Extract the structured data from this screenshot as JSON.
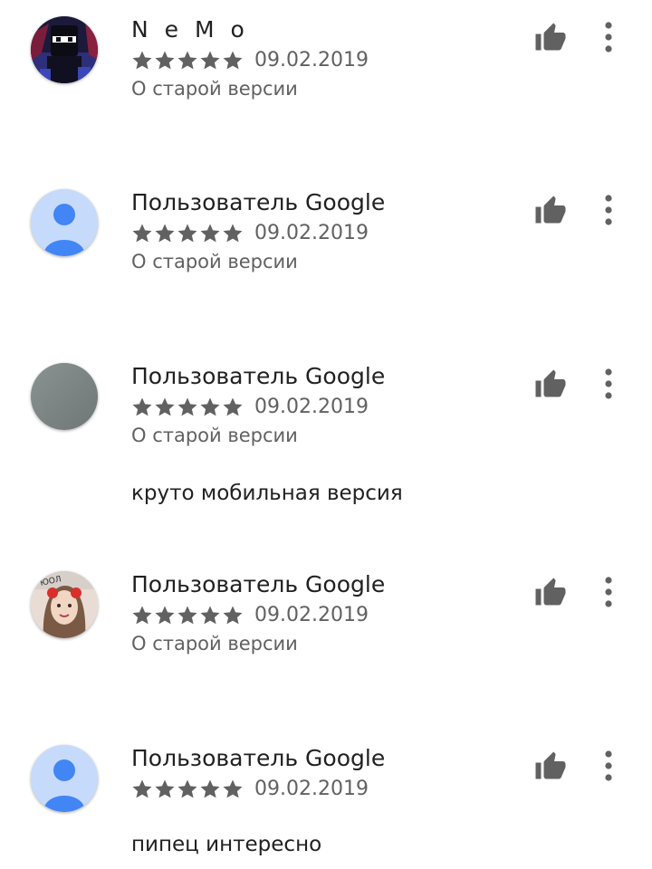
{
  "reviews": [
    {
      "author": "N e M o",
      "rating": 5,
      "date": "09.02.2019",
      "version_note": "О старой версии",
      "text": "",
      "avatar": "ninja-avatar"
    },
    {
      "author": "Пользователь Google",
      "rating": 5,
      "date": "09.02.2019",
      "version_note": "О старой версии",
      "text": "",
      "avatar": "default-user-avatar"
    },
    {
      "author": "Пользователь Google",
      "rating": 5,
      "date": "09.02.2019",
      "version_note": "О старой версии",
      "text": "круто мобильная версия",
      "avatar": "gray-avatar"
    },
    {
      "author": "Пользователь Google",
      "rating": 5,
      "date": "09.02.2019",
      "version_note": "О старой версии",
      "text": "",
      "avatar": "photo-avatar"
    },
    {
      "author": "Пользователь Google",
      "rating": 5,
      "date": "09.02.2019",
      "version_note": "",
      "text": "пипец интересно",
      "avatar": "default-user-avatar"
    }
  ],
  "icons": {
    "like": "thumb-up-icon",
    "more": "more-vert-icon",
    "star": "star-icon"
  },
  "colors": {
    "text_primary": "#212121",
    "text_secondary": "#616161",
    "star": "#616161",
    "icon": "#616161",
    "default_avatar_bg": "#c6dafc",
    "default_avatar_fg": "#4285f4"
  }
}
